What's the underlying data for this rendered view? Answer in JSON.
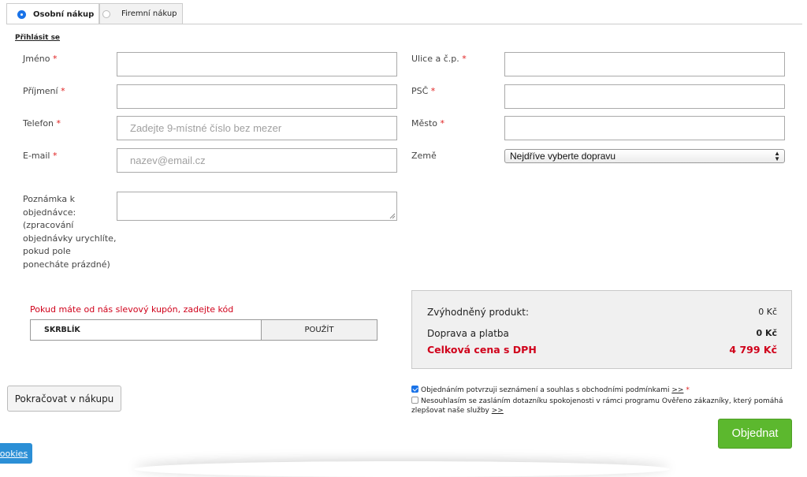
{
  "tabs": [
    {
      "label": "Osobní nákup",
      "selected": true
    },
    {
      "label": "Firemní nákup",
      "selected": false
    }
  ],
  "login_link": "Přihlásit se",
  "required_mark": "*",
  "fields": {
    "first_name": {
      "label": "Jméno",
      "value": "",
      "placeholder": ""
    },
    "last_name": {
      "label": "Příjmení",
      "value": "",
      "placeholder": ""
    },
    "phone": {
      "label": "Telefon",
      "value": "",
      "placeholder": "Zadejte 9-místné číslo bez mezer"
    },
    "email": {
      "label": "E-mail",
      "value": "",
      "placeholder": "nazev@email.cz"
    },
    "street": {
      "label": "Ulice a č.p.",
      "value": ""
    },
    "zip": {
      "label": "PSČ",
      "value": ""
    },
    "city": {
      "label": "Město",
      "value": ""
    },
    "country": {
      "label": "Země",
      "selected": "Nejdříve vyberte dopravu"
    }
  },
  "note": {
    "label": "Poznámka k objednávce: (zpracování objednávky urychlíte, pokud pole ponecháte prázdné)",
    "value": ""
  },
  "coupon": {
    "title": "Pokud máte od nás slevový kupón, zadejte kód",
    "value": "SKRBLÍK",
    "button": "POUŽÍT"
  },
  "summary": {
    "product_label": "Zvýhodněný produkt:",
    "product_value": "0 Kč",
    "shipping_label": "Doprava a platba",
    "shipping_value": "0 Kč",
    "total_label": "Celková cena s DPH",
    "total_value": "4 799 Kč"
  },
  "continue_button": "Pokračovat v nákupu",
  "consent": {
    "terms_text": "Objednáním potvrzuji seznámení a souhlas s obchodními podmínkami",
    "terms_checked": true,
    "survey_text": "Nesouhlasím se zasláním dotazníku spokojenosti v rámci programu Ověřeno zákazníky, který pomáhá zlepšovat naše služby",
    "survey_checked": false,
    "link_text": ">>"
  },
  "order_button": "Objednat",
  "cookies_button": "ookies",
  "colors": {
    "accent_blue": "#1a73e8",
    "required_red": "#e02020",
    "total_red": "#d0021b",
    "order_green": "#5cb82e",
    "cookies_blue": "#2b8fd6"
  }
}
